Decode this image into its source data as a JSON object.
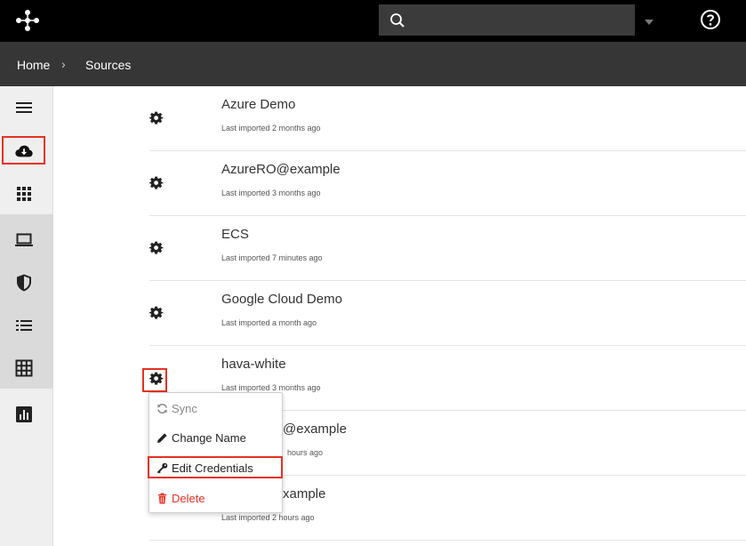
{
  "header": {
    "logo": "hava-logo-icon",
    "search": {
      "placeholder": "",
      "value": ""
    },
    "help_icon": "help-circle-icon"
  },
  "breadcrumb": {
    "home": "Home",
    "separator": "›",
    "current": "Sources"
  },
  "sidebar": {
    "items": [
      {
        "icon": "menu-icon"
      },
      {
        "icon": "cloud-download-icon",
        "active": true
      },
      {
        "icon": "apps-grid-icon"
      },
      {
        "icon": "laptop-icon"
      },
      {
        "icon": "shield-icon"
      },
      {
        "icon": "list-icon"
      },
      {
        "icon": "table-grid-icon"
      },
      {
        "icon": "bar-chart-icon"
      }
    ]
  },
  "sources": [
    {
      "name": "Azure Demo",
      "last_imported": "Last imported 2 months ago"
    },
    {
      "name": "AzureRO@example",
      "last_imported": "Last imported 3 months ago"
    },
    {
      "name": "ECS",
      "last_imported": "Last imported 7 minutes ago"
    },
    {
      "name": "Google Cloud Demo",
      "last_imported": "Last imported a month ago"
    },
    {
      "name": "hava-white",
      "last_imported": "Last imported 3 months ago"
    },
    {
      "name": "@example",
      "last_imported": "hours ago"
    },
    {
      "name": "xample",
      "last_imported": "Last imported 2 hours ago"
    }
  ],
  "context_menu": {
    "sync": "Sync",
    "change_name": "Change Name",
    "edit_credentials": "Edit Credentials",
    "delete": "Delete"
  },
  "colors": {
    "highlight": "#e53224",
    "topbar": "#000000",
    "breadcrumb_bar": "#363636",
    "delete": "#e53224"
  }
}
